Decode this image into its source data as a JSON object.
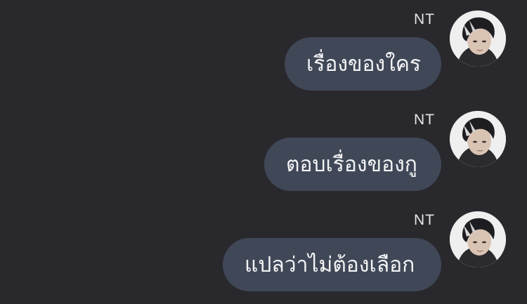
{
  "messages": [
    {
      "sender": "NT",
      "text": "เรื่องของใคร",
      "avatar": "profile-photo"
    },
    {
      "sender": "NT",
      "text": "ตอบเรื่องของกู",
      "avatar": "profile-photo"
    },
    {
      "sender": "NT",
      "text": "แปลว่าไม่ต้องเลือก",
      "avatar": "profile-photo"
    }
  ],
  "colors": {
    "background": "#29292d",
    "bubble": "#404858",
    "text": "#f4f4f6"
  }
}
